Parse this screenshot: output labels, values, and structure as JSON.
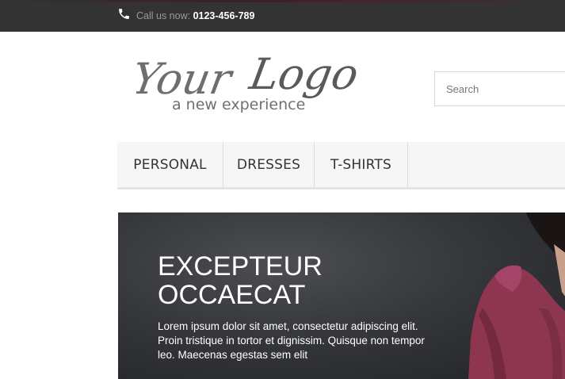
{
  "topbar": {
    "call_label": "Call us now:",
    "phone_number": "0123-456-789",
    "icon": "phone-icon"
  },
  "logo": {
    "word1": "Your",
    "word2": "Logo",
    "tagline": "a new experience"
  },
  "search": {
    "placeholder": "Search",
    "value": ""
  },
  "menu": {
    "items": [
      {
        "label": "PERSONAL"
      },
      {
        "label": "DRESSES"
      },
      {
        "label": "T-SHIRTS"
      }
    ]
  },
  "banner": {
    "title_line1": "EXCEPTEUR",
    "title_line2": "OCCAECAT",
    "body": "Lorem ipsum dolor sit amet, consectetur adipiscing elit. Proin tristique in tortor et dignissim. Quisque non tempor leo. Maecenas egestas sem elit"
  },
  "colors": {
    "topbar": "#333333",
    "menu_bg": "#f6f6f6",
    "logo_gray": "#6e6e6e",
    "banner_dark": "#2c2d2f",
    "dress_red": "#8e3550"
  }
}
